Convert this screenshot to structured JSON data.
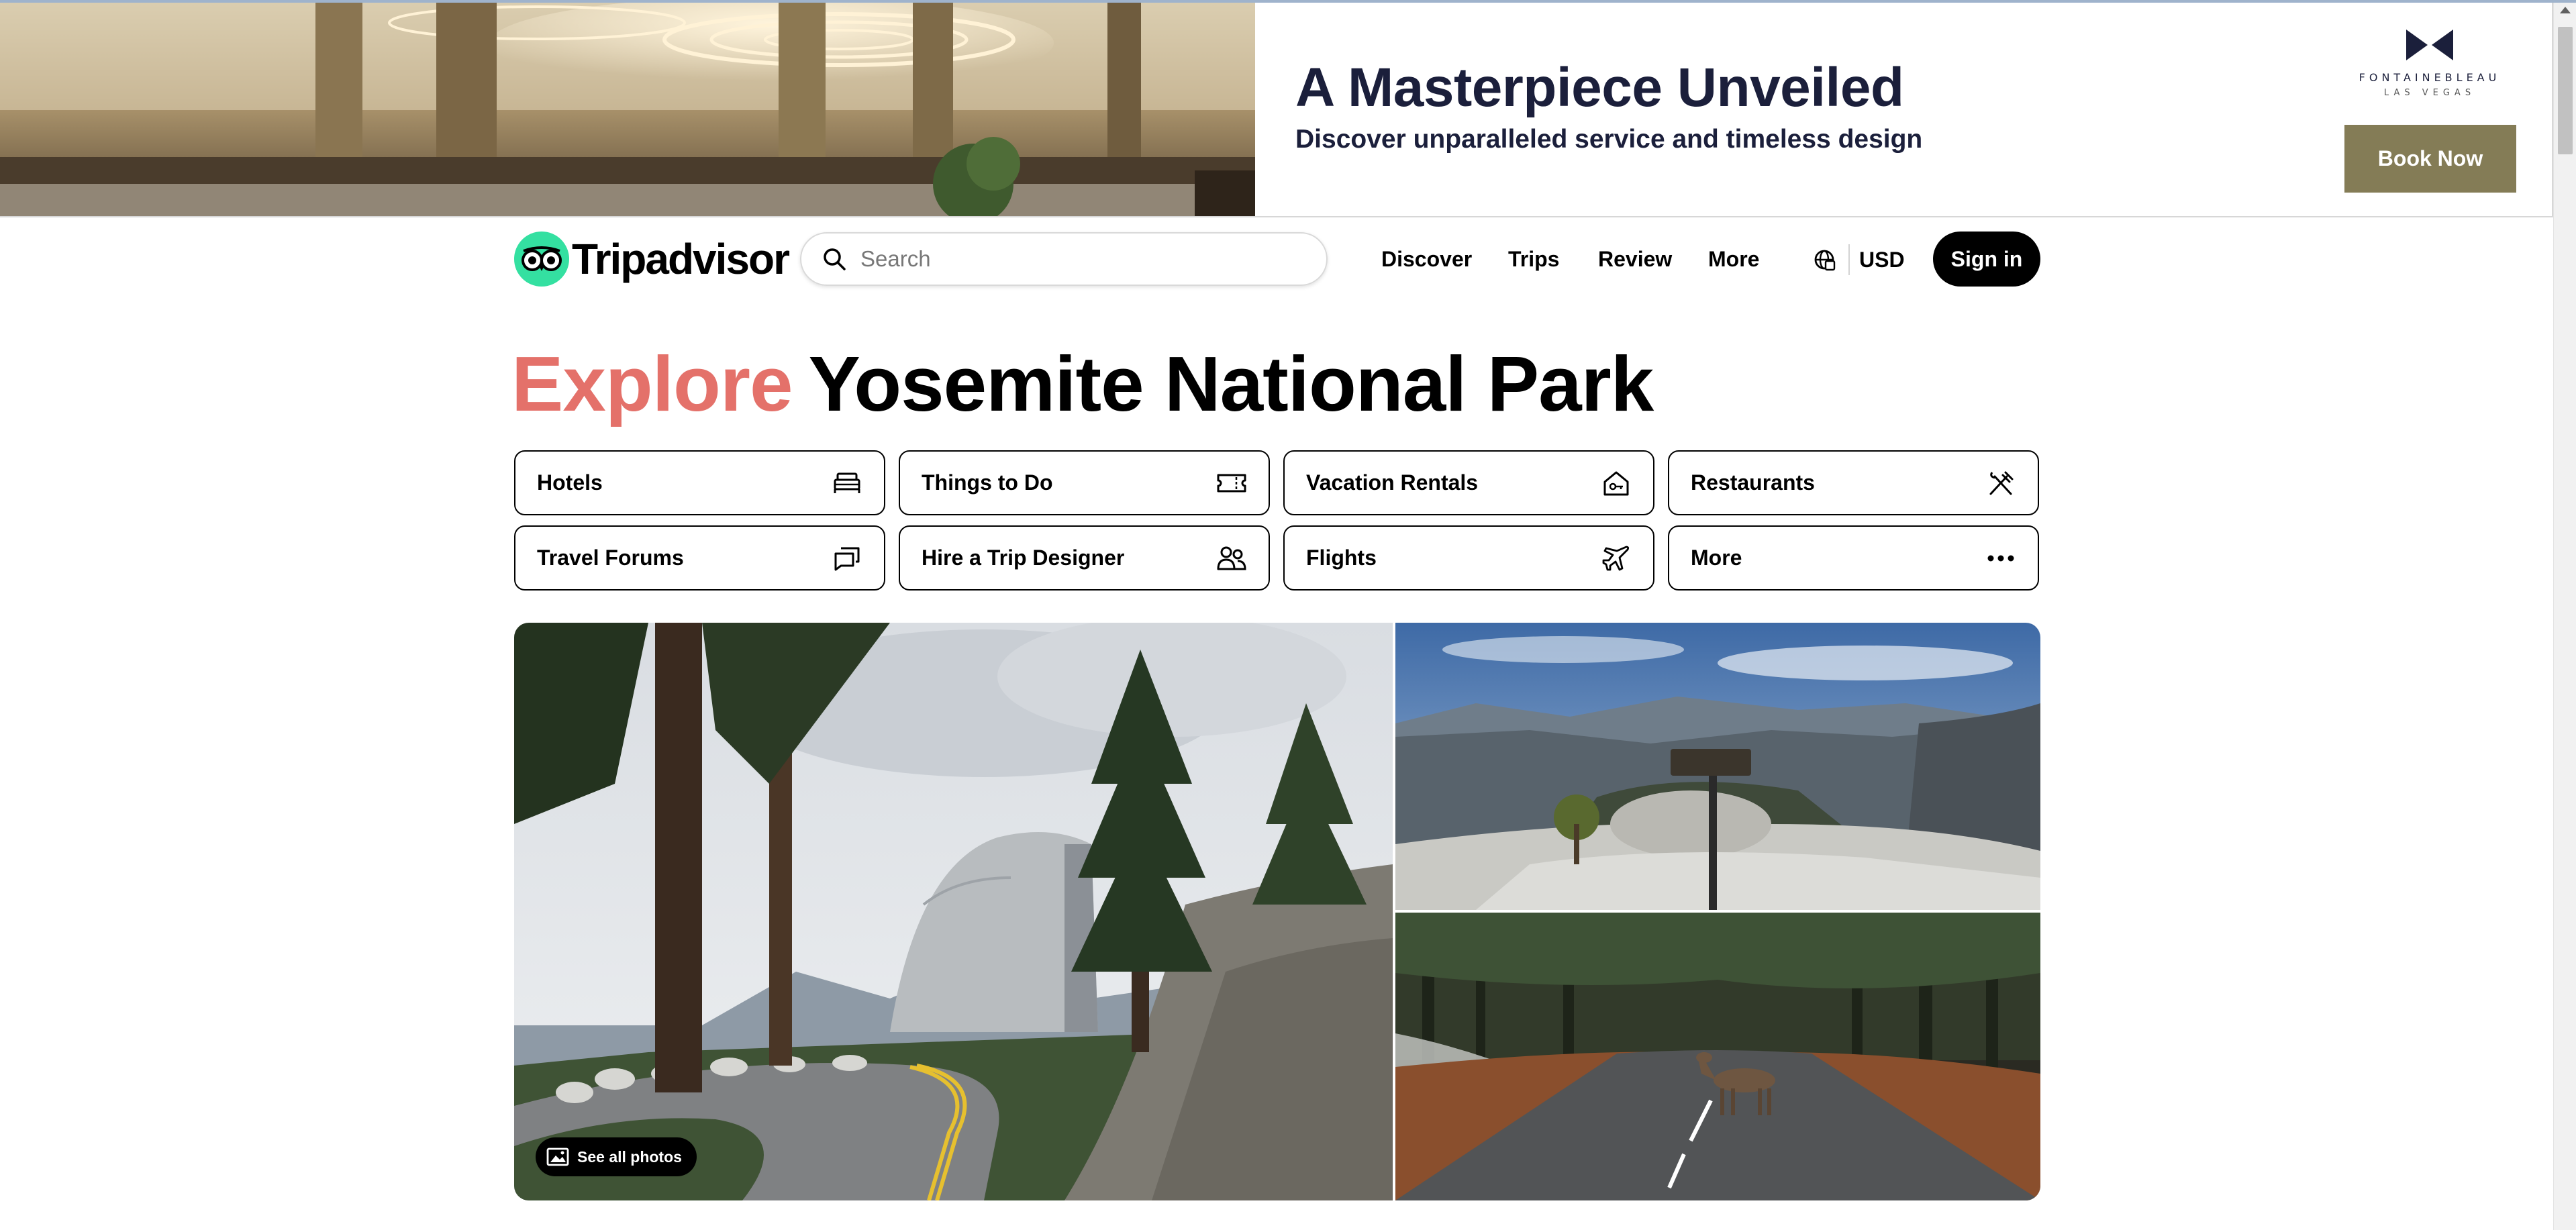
{
  "ad": {
    "title": "A Masterpiece Unveiled",
    "subtitle": "Discover unparalleled service and timeless design",
    "brand": "FONTAINEBLEAU",
    "city": "LAS VEGAS",
    "cta": "Book Now"
  },
  "header": {
    "logo_text": "Tripadvisor",
    "search_placeholder": "Search",
    "nav": [
      "Discover",
      "Trips",
      "Review",
      "More"
    ],
    "currency": "USD",
    "sign_in": "Sign in"
  },
  "hero": {
    "accent": "Explore",
    "place": "Yosemite National Park"
  },
  "categories": [
    {
      "label": "Hotels",
      "icon": "bed-icon"
    },
    {
      "label": "Things to Do",
      "icon": "ticket-icon"
    },
    {
      "label": "Vacation Rentals",
      "icon": "house-key-icon"
    },
    {
      "label": "Restaurants",
      "icon": "fork-knife-icon"
    },
    {
      "label": "Travel Forums",
      "icon": "chat-bubbles-icon"
    },
    {
      "label": "Hire a Trip Designer",
      "icon": "people-icon"
    },
    {
      "label": "Flights",
      "icon": "airplane-icon"
    },
    {
      "label": "More",
      "icon": "more-dots-icon"
    }
  ],
  "gallery": {
    "see_all": "See all photos"
  },
  "colors": {
    "accent": "#e4716a",
    "brand_green": "#34e0a1",
    "ad_cta": "#847c56",
    "ad_text": "#1b1f3b"
  }
}
